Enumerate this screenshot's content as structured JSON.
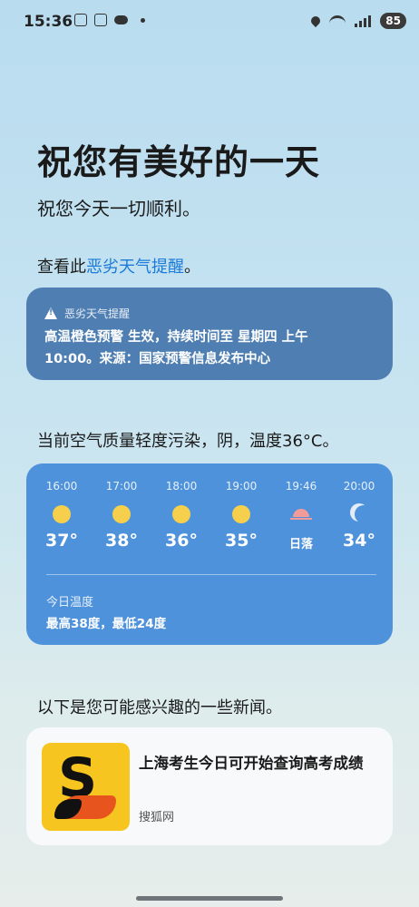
{
  "status_bar": {
    "time": "15:36",
    "battery": "85"
  },
  "greeting": {
    "title": "祝您有美好的一天",
    "subtitle": "祝您今天一切顺利。",
    "check_prefix": "查看此",
    "check_link": "恶劣天气提醒",
    "check_suffix": "。"
  },
  "alert": {
    "header": "恶劣天气提醒",
    "line1": "高温橙色预警 生效，持续时间至 星期四 上午",
    "line2": "10:00。来源：国家预警信息发布中心"
  },
  "weather": {
    "summary": "当前空气质量轻度污染，阴，温度36°C。",
    "hours": [
      {
        "time": "16:00",
        "icon": "sun-icon",
        "value": "37°"
      },
      {
        "time": "17:00",
        "icon": "sun-icon",
        "value": "38°"
      },
      {
        "time": "18:00",
        "icon": "sun-icon",
        "value": "36°"
      },
      {
        "time": "19:00",
        "icon": "sun-icon",
        "value": "35°"
      },
      {
        "time": "19:46",
        "icon": "sunset-icon",
        "value": "日落"
      },
      {
        "time": "20:00",
        "icon": "moon-icon",
        "value": "34°"
      }
    ],
    "today_label": "今日温度",
    "today_range": "最高38度，最低24度"
  },
  "news": {
    "intro": "以下是您可能感兴趣的一些新闻。",
    "items": [
      {
        "title": "上海考生今日可开始查询高考成绩",
        "source": "搜狐网",
        "thumb_letter": "S"
      }
    ]
  },
  "colors": {
    "alert_card": "#4f7fb2",
    "weather_card": "#4f92dc",
    "link": "#1c7ad8",
    "thumb": "#f7c51f"
  }
}
